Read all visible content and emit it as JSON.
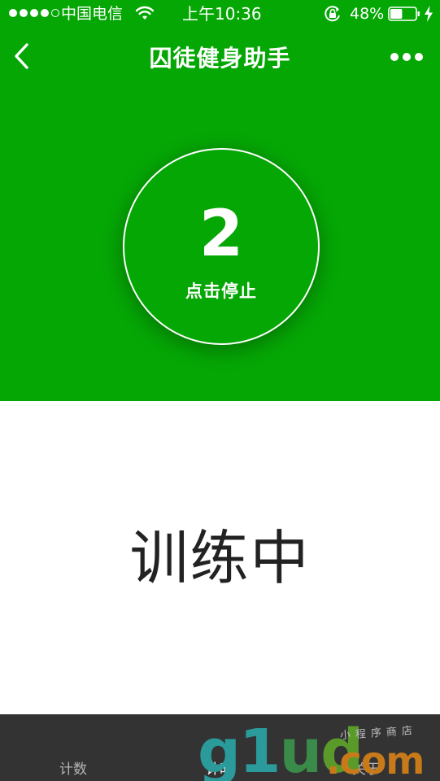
{
  "status_bar": {
    "carrier": "中国电信",
    "time": "上午10:36",
    "battery_percent": "48%",
    "battery_level": 0.48,
    "signal_bars_filled": 4,
    "signal_bars_total": 5,
    "icons": [
      "signal-dots-icon",
      "wifi-icon",
      "rotation-lock-icon",
      "battery-icon",
      "charging-bolt-icon"
    ]
  },
  "nav": {
    "title": "囚徒健身助手",
    "back_icon": "chevron-left-icon",
    "more_icon": "more-dots-icon"
  },
  "counter": {
    "value": "2",
    "label": "点击停止"
  },
  "main": {
    "status_text": "训练中"
  },
  "tabbar": {
    "tabs": [
      {
        "label": "计数",
        "active": false
      },
      {
        "label": "计时",
        "active": true
      },
      {
        "label": "关于",
        "active": false
      }
    ]
  },
  "watermark": {
    "main": "g1ud",
    "suffix": ".com",
    "tag": "小程序商店"
  },
  "colors": {
    "primary_green": "#05a705",
    "tabbar_bg": "#333333",
    "text_dark": "#222222",
    "white": "#ffffff"
  }
}
